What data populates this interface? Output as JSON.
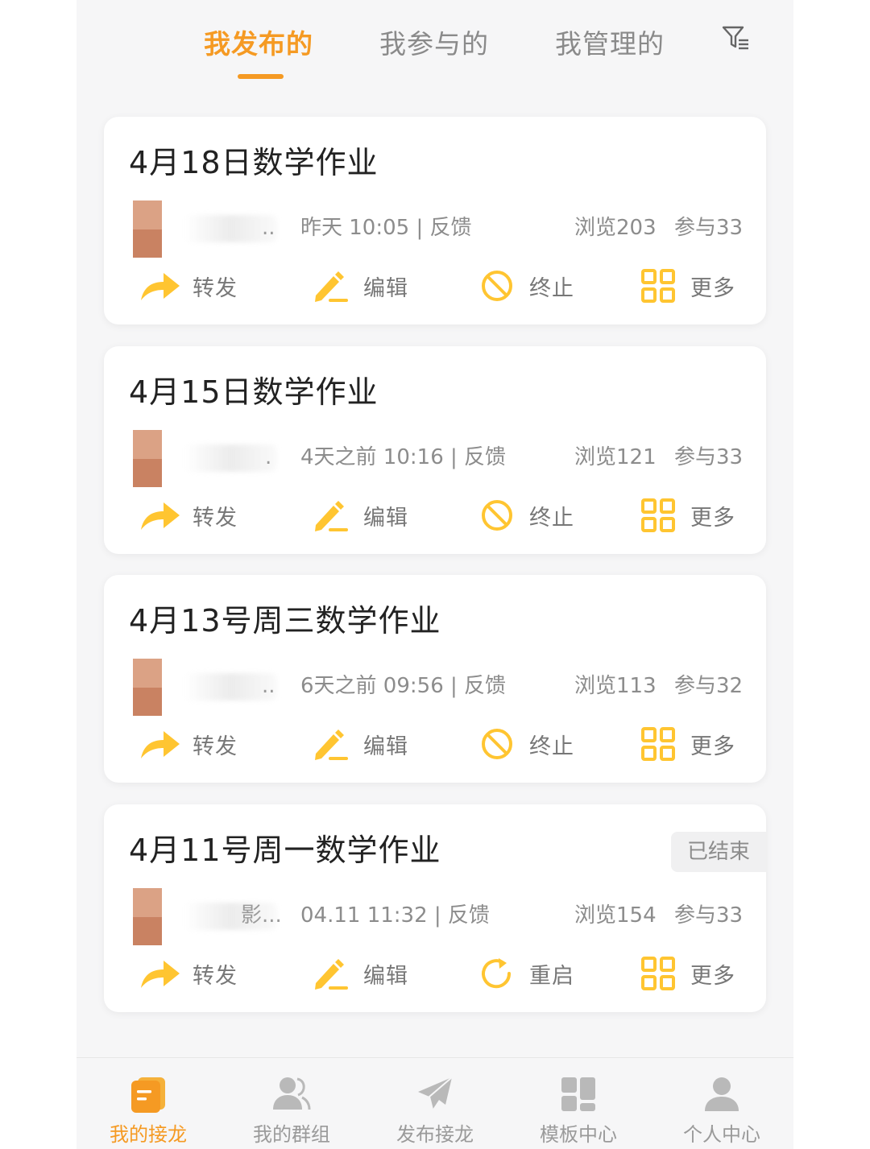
{
  "tabs": [
    {
      "label": "我发布的",
      "active": true
    },
    {
      "label": "我参与的",
      "active": false
    },
    {
      "label": "我管理的",
      "active": false
    }
  ],
  "colors": {
    "accent": "#f59a23",
    "icon_yellow": "#ffc531",
    "text": "#222222",
    "muted": "#8c8c8c"
  },
  "cards": [
    {
      "title": "4月18日数学作业",
      "name_dots": "..",
      "meta": "昨天 10:05 | 反馈",
      "views": "浏览203",
      "participants": "参与33",
      "status": "",
      "actions": [
        {
          "label": "转发",
          "icon": "forward-icon"
        },
        {
          "label": "编辑",
          "icon": "edit-icon"
        },
        {
          "label": "终止",
          "icon": "stop-icon"
        },
        {
          "label": "更多",
          "icon": "grid-icon"
        }
      ]
    },
    {
      "title": "4月15日数学作业",
      "name_dots": ".",
      "meta": "4天之前 10:16 | 反馈",
      "views": "浏览121",
      "participants": "参与33",
      "status": "",
      "actions": [
        {
          "label": "转发",
          "icon": "forward-icon"
        },
        {
          "label": "编辑",
          "icon": "edit-icon"
        },
        {
          "label": "终止",
          "icon": "stop-icon"
        },
        {
          "label": "更多",
          "icon": "grid-icon"
        }
      ]
    },
    {
      "title": "4月13号周三数学作业",
      "name_dots": "..",
      "meta": "6天之前 09:56 | 反馈",
      "views": "浏览113",
      "participants": "参与32",
      "status": "",
      "actions": [
        {
          "label": "转发",
          "icon": "forward-icon"
        },
        {
          "label": "编辑",
          "icon": "edit-icon"
        },
        {
          "label": "终止",
          "icon": "stop-icon"
        },
        {
          "label": "更多",
          "icon": "grid-icon"
        }
      ]
    },
    {
      "title": "4月11号周一数学作业",
      "name_dots": "影...",
      "meta": "04.11 11:32 | 反馈",
      "views": "浏览154",
      "participants": "参与33",
      "status": "已结束",
      "actions": [
        {
          "label": "转发",
          "icon": "forward-icon"
        },
        {
          "label": "编辑",
          "icon": "edit-icon"
        },
        {
          "label": "重启",
          "icon": "restart-icon"
        },
        {
          "label": "更多",
          "icon": "grid-icon"
        }
      ]
    }
  ],
  "bottom_nav": [
    {
      "label": "我的接龙",
      "icon": "note-icon",
      "active": true
    },
    {
      "label": "我的群组",
      "icon": "group-icon",
      "active": false
    },
    {
      "label": "发布接龙",
      "icon": "send-icon",
      "active": false
    },
    {
      "label": "模板中心",
      "icon": "template-icon",
      "active": false
    },
    {
      "label": "个人中心",
      "icon": "user-icon",
      "active": false
    }
  ]
}
